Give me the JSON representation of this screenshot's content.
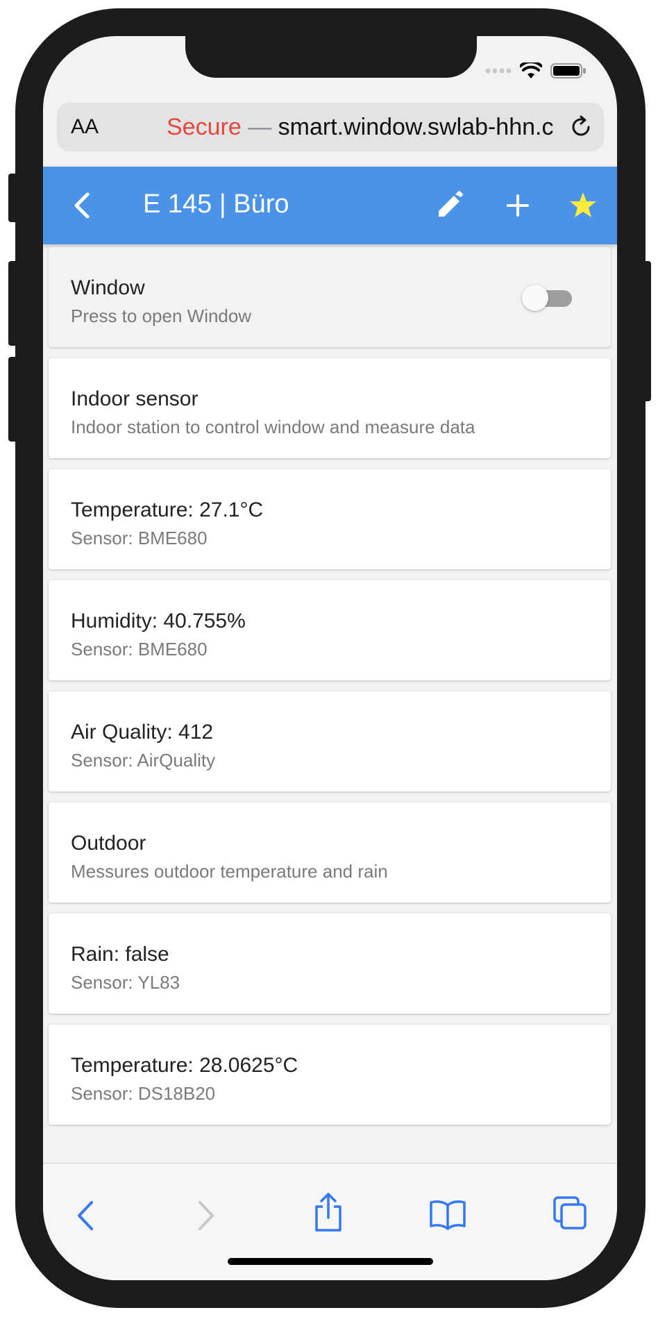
{
  "browser": {
    "text_size_label": "AA",
    "url_secure": "Secure",
    "url_separator": "—",
    "url_host": "smart.window.swlab-hhn.c"
  },
  "appbar": {
    "title": "E 145 | Büro",
    "back_icon": "arrow-back-icon",
    "edit_icon": "pencil-icon",
    "add_icon": "plus-icon",
    "favorite_icon": "star-icon",
    "favorite_color": "#ffeb3b",
    "background_color": "#4a93e8"
  },
  "items": [
    {
      "primary": "Window",
      "secondary": "Press to open Window",
      "toggle_on": false
    },
    {
      "primary": "Indoor sensor",
      "secondary": "Indoor station to control window and measure data"
    },
    {
      "primary": "Temperature: 27.1°C",
      "secondary": "Sensor: BME680"
    },
    {
      "primary": "Humidity: 40.755%",
      "secondary": "Sensor: BME680"
    },
    {
      "primary": "Air Quality: 412",
      "secondary": "Sensor: AirQuality"
    },
    {
      "primary": "Outdoor",
      "secondary": "Messures outdoor temperature and rain"
    },
    {
      "primary": "Rain: false",
      "secondary": "Sensor: YL83"
    },
    {
      "primary": "Temperature: 28.0625°C",
      "secondary": "Sensor: DS18B20"
    }
  ],
  "toolbar": {
    "icons": [
      "back-icon",
      "forward-icon",
      "share-icon",
      "bookmarks-icon",
      "tabs-icon"
    ],
    "accent_color": "#3478f6"
  }
}
